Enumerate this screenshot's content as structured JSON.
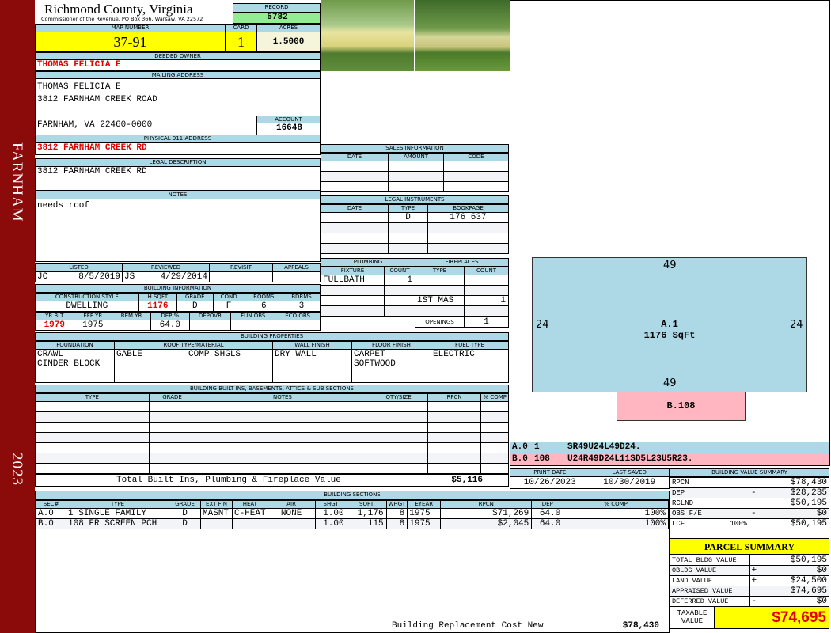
{
  "sidebar": {
    "district": "FARNHAM",
    "year": "2023"
  },
  "header": {
    "county": "Richmond County, Virginia",
    "office": "Commissioner of the Revenue, PO Box 366, Warsaw, VA 22572",
    "record_label": "RECORD",
    "record": "5782"
  },
  "parcel": {
    "map_label": "MAP NUMBER",
    "map": "37-91",
    "card_label": "CARD",
    "card": "1",
    "acres_label": "ACRES",
    "acres": "1.5000"
  },
  "owner": {
    "label": "DEEDED OWNER",
    "name": "THOMAS FELICIA E"
  },
  "mailing": {
    "label": "MAILING ADDRESS",
    "lines": [
      "THOMAS FELICIA E",
      "3812 FARNHAM CREEK ROAD",
      "",
      "FARNHAM, VA 22460-0000"
    ],
    "account_label": "ACCOUNT",
    "account": "16648"
  },
  "physical": {
    "label": "PHYSICAL 911 ADDRESS",
    "value": "3812 FARNHAM CREEK RD"
  },
  "legal": {
    "label": "LEGAL DESCRIPTION",
    "value": "3812 FARNHAM CREEK RD"
  },
  "notes": {
    "label": "NOTES",
    "value": "needs roof"
  },
  "review": {
    "headers": [
      "LISTED",
      "REVIEWED",
      "REVISIT",
      "APPEALS"
    ],
    "listed_by": "JC",
    "listed_date": "8/5/2019",
    "reviewed_by": "JS",
    "reviewed_date": "4/29/2014"
  },
  "building_info": {
    "label": "BUILDING INFORMATION",
    "headers1": [
      "CONSTRUCTION STYLE",
      "H SQFT",
      "GRADE",
      "COND",
      "ROOMS",
      "BDRMS"
    ],
    "values1": [
      "DWELLING",
      "1176",
      "D",
      "F",
      "6",
      "3"
    ],
    "headers2": [
      "YR BLT",
      "EFF YR",
      "REM YR",
      "DEP %",
      "DEPOVR",
      "FUN OBS",
      "ECO OBS"
    ],
    "values2": [
      "1979",
      "1975",
      "",
      "64.0",
      "",
      "",
      ""
    ]
  },
  "sales": {
    "label": "SALES INFORMATION",
    "headers": [
      "DATE",
      "AMOUNT",
      "CODE"
    ],
    "rows": [
      [
        "",
        "",
        ""
      ],
      [
        "",
        "",
        ""
      ],
      [
        "",
        "",
        ""
      ]
    ]
  },
  "instruments": {
    "label": "LEGAL INSTRUMENTS",
    "headers": [
      "DATE",
      "TYPE",
      "BOOKPAGE"
    ],
    "rows": [
      [
        "",
        "D",
        "176 637"
      ],
      [
        "",
        "",
        ""
      ],
      [
        "",
        "",
        ""
      ],
      [
        "",
        "",
        ""
      ]
    ]
  },
  "plumbing": {
    "label": "PLUMBING",
    "headers": [
      "FIXTURE",
      "COUNT"
    ],
    "rows": [
      [
        "FULLBATH",
        "1"
      ],
      [
        "",
        ""
      ],
      [
        "",
        ""
      ],
      [
        "",
        ""
      ]
    ]
  },
  "fireplaces": {
    "label": "FIREPLACES",
    "headers": [
      "TYPE",
      "COUNT"
    ],
    "rows": [
      [
        "",
        ""
      ],
      [
        "",
        ""
      ],
      [
        "1ST MAS",
        "1"
      ],
      [
        "",
        ""
      ]
    ],
    "openings_label": "OPENINGS",
    "openings": "1"
  },
  "properties": {
    "label": "BUILDING PROPERTIES",
    "headers": [
      "FOUNDATION",
      "ROOF TYPE/MATERIAL",
      "WALL FINISH",
      "FLOOR FINISH",
      "FUEL TYPE"
    ],
    "foundation": [
      "CRAWL",
      "CINDER BLOCK"
    ],
    "roof_type": "GABLE",
    "roof_material": "COMP SHGLS",
    "wall": "DRY WALL",
    "floor": [
      "CARPET",
      "SOFTWOOD"
    ],
    "fuel": "ELECTRIC"
  },
  "builtins": {
    "label": "BUILDING BUILT INS, BASEMENTS, ATTICS & SUB SECTIONS",
    "headers": [
      "TYPE",
      "GRADE",
      "NOTES",
      "QTY/SIZE",
      "RPCN",
      "% COMP"
    ],
    "total_label": "Total Built Ins, Plumbing & Fireplace Value",
    "total": "$5,116"
  },
  "dates": {
    "print_label": "PRINT DATE",
    "print": "10/26/2023",
    "saved_label": "LAST SAVED",
    "saved": "10/30/2019"
  },
  "sections": {
    "label": "BUILDING SECTIONS",
    "headers": [
      "SEC#",
      "TYPE",
      "GRADE",
      "EXT FIN",
      "HEAT",
      "AIR",
      "SHGT",
      "SQFT",
      "WHGT",
      "EYEAR",
      "RPCN",
      "DEP",
      "% COMP"
    ],
    "rows": [
      [
        "A.0",
        "1 SINGLE FAMILY",
        "D",
        "MASNT",
        "C-HEAT",
        "NONE",
        "1.00",
        "1,176",
        "8",
        "1975",
        "$71,269",
        "64.0",
        "100%"
      ],
      [
        "B.0",
        "108 FR SCREEN PCH",
        "D",
        "",
        "",
        "",
        "1.00",
        "115",
        "8",
        "1975",
        "$2,045",
        "64.0",
        "100%"
      ]
    ],
    "replacement_label": "Building Replacement Cost New",
    "replacement": "$78,430"
  },
  "sketch": {
    "main_label": "A.1",
    "main_area": "1176 SqFt",
    "top": "49",
    "bottom": "49",
    "left": "24",
    "right": "24",
    "porch_label": "B.108",
    "colors": {
      "main": "#add8e6",
      "porch": "#ffb6c1"
    },
    "legend": [
      [
        "A.0",
        "1",
        "SR49U24L49D24."
      ],
      [
        "B.0",
        "108",
        "U24R49D24L11SD5L23U5R23."
      ]
    ]
  },
  "value_summary": {
    "label": "BUILDING VALUE SUMMARY",
    "rows": [
      [
        "RPCN",
        "",
        "",
        "$78,430"
      ],
      [
        "DEP",
        "",
        "-",
        "$28,235"
      ],
      [
        "RCLND",
        "",
        "",
        "$50,195"
      ],
      [
        "OBS F/E",
        "",
        "-",
        "$0"
      ],
      [
        "LCF",
        "100%",
        "",
        "$50,195"
      ]
    ]
  },
  "parcel_summary": {
    "label": "PARCEL SUMMARY",
    "rows": [
      [
        "TOTAL BLDG VALUE",
        "",
        "$50,195"
      ],
      [
        "OBLDG VALUE",
        "+",
        "$0"
      ],
      [
        "LAND VALUE",
        "+",
        "$24,500"
      ],
      [
        "APPRAISED VALUE",
        "",
        "$74,695"
      ],
      [
        "DEFERRED VALUE",
        "-",
        "$0"
      ]
    ],
    "taxable_label": "TAXABLE VALUE",
    "taxable": "$74,695"
  }
}
